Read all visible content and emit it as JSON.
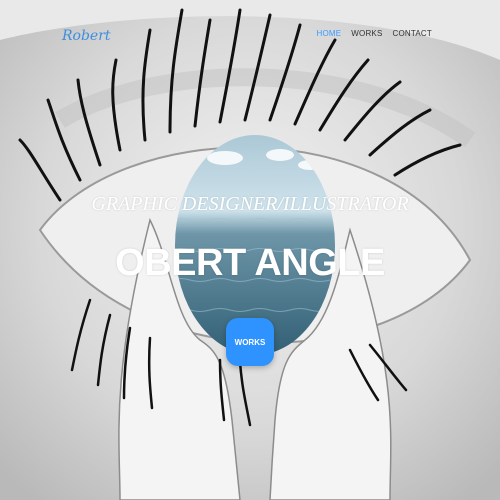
{
  "brand": {
    "logo_text": "Robert",
    "accent": "#3b9aff"
  },
  "nav": {
    "items": [
      {
        "label": "HOME",
        "active": true
      },
      {
        "label": "WORKS",
        "active": false
      },
      {
        "label": "CONTACT",
        "active": false
      }
    ]
  },
  "hero": {
    "subtitle": "GRAPHIC DESIGNER/ILLUSTRATOR",
    "title": "OBERT ANGLE",
    "cta_label": "WORKS",
    "background": "eye-illustration"
  }
}
